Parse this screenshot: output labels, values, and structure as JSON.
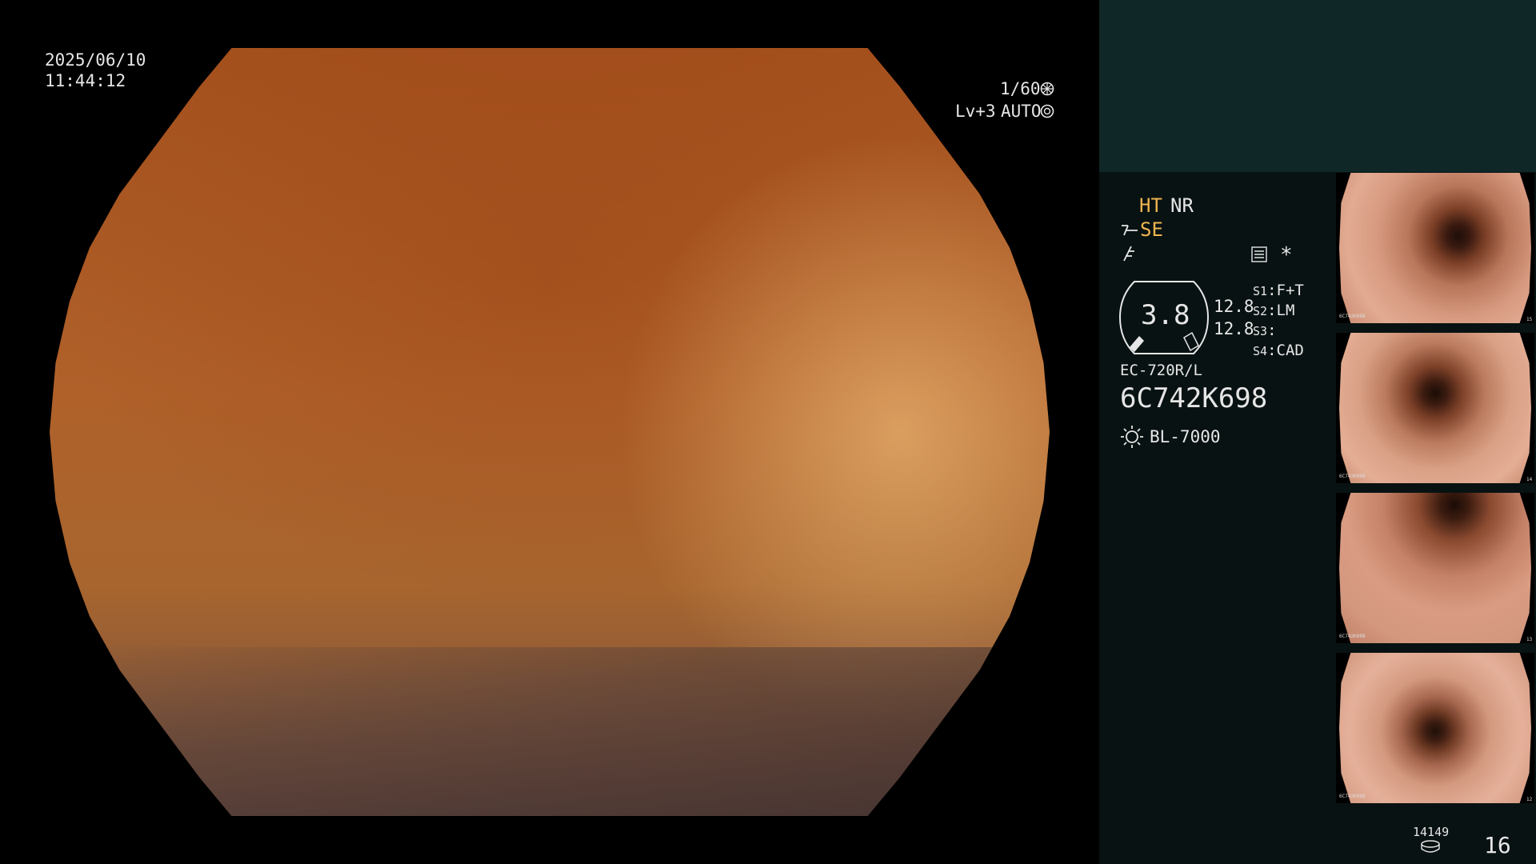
{
  "overlay": {
    "date": "2025/06/10",
    "time": "11:44:12",
    "shutter": "1/60",
    "level": "Lv+3",
    "iris_mode": "AUTO"
  },
  "panel": {
    "ht": "HT",
    "nr": "NR",
    "se": "SE",
    "dial_value": "3.8",
    "zoom_values": [
      "12.8",
      "12.8"
    ],
    "switches": [
      {
        "key": "S1",
        "value": "F+T"
      },
      {
        "key": "S2",
        "value": "LM"
      },
      {
        "key": "S3",
        "value": ""
      },
      {
        "key": "S4",
        "value": "CAD"
      }
    ],
    "asterisk": "*",
    "scope_model": "EC-720R/L",
    "serial": "6C742K698",
    "light_source": "BL-7000",
    "image_count": "14149",
    "page_number": "16"
  },
  "thumbnails": [
    {
      "id": "6C742K698",
      "index": "15"
    },
    {
      "id": "6C742K698",
      "index": "14"
    },
    {
      "id": "6C742K698",
      "index": "13"
    },
    {
      "id": "6C742K698",
      "index": "12"
    }
  ],
  "icons": {
    "shutter": "shutter-icon",
    "iris": "iris-icon",
    "storage": "storage-icon",
    "light": "light-source-icon",
    "settings": "settings-icon"
  },
  "colors": {
    "accent": "#f0b450",
    "panel_top": "#0f2727",
    "panel_bg": "#081212"
  }
}
